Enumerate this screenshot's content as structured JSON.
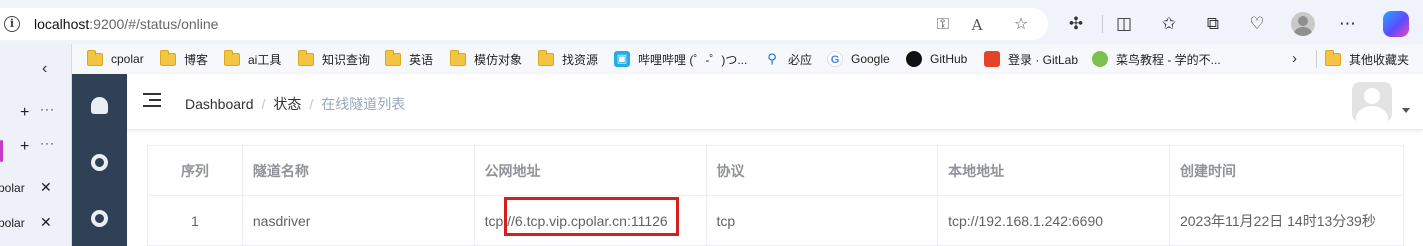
{
  "browser": {
    "url": {
      "host": "localhost",
      "rest": ":9200/#/status/online"
    },
    "toolbar_icons": [
      "key-icon",
      "read-aloud-icon",
      "favorite-star-icon",
      "extensions-icon",
      "split-screen-icon",
      "favorites-icon",
      "collections-icon",
      "health-icon",
      "profile-icon",
      "copilot-icon"
    ]
  },
  "bookmarks": [
    {
      "label": "cpolar",
      "icon": "folder"
    },
    {
      "label": "博客",
      "icon": "folder"
    },
    {
      "label": "ai工具",
      "icon": "folder"
    },
    {
      "label": "知识查询",
      "icon": "folder"
    },
    {
      "label": "英语",
      "icon": "folder"
    },
    {
      "label": "模仿对象",
      "icon": "folder"
    },
    {
      "label": "找资源",
      "icon": "folder"
    },
    {
      "label": "哔哩哔哩 (゜-゜)つ...",
      "icon": "bilibili"
    },
    {
      "label": "必应",
      "icon": "bing"
    },
    {
      "label": "Google",
      "icon": "google"
    },
    {
      "label": "GitHub",
      "icon": "github"
    },
    {
      "label": "登录 · GitLab",
      "icon": "gitlab"
    },
    {
      "label": "菜鸟教程 - 学的不...",
      "icon": "runoob"
    },
    {
      "label": "其他收藏夹",
      "icon": "folder"
    }
  ],
  "vertical_tabs": {
    "rows": [
      {
        "label": "cpolar"
      },
      {
        "label": "cpolar"
      }
    ]
  },
  "breadcrumb": {
    "items": [
      "Dashboard",
      "状态"
    ],
    "separator": "/",
    "current": "在线隧道列表"
  },
  "table": {
    "headers": [
      "序列",
      "隧道名称",
      "公网地址",
      "协议",
      "本地地址",
      "创建时间"
    ],
    "rows": [
      [
        "1",
        "nasdriver",
        "tcp://6.tcp.vip.cpolar.cn:11126",
        "tcp",
        "tcp://192.168.1.242:6690",
        "2023年11月22日 14时13分39秒"
      ]
    ]
  },
  "colors": {
    "sidebar": "#304156",
    "highlight": "#d4201c",
    "breadcrumb_current": "#97a8be"
  }
}
